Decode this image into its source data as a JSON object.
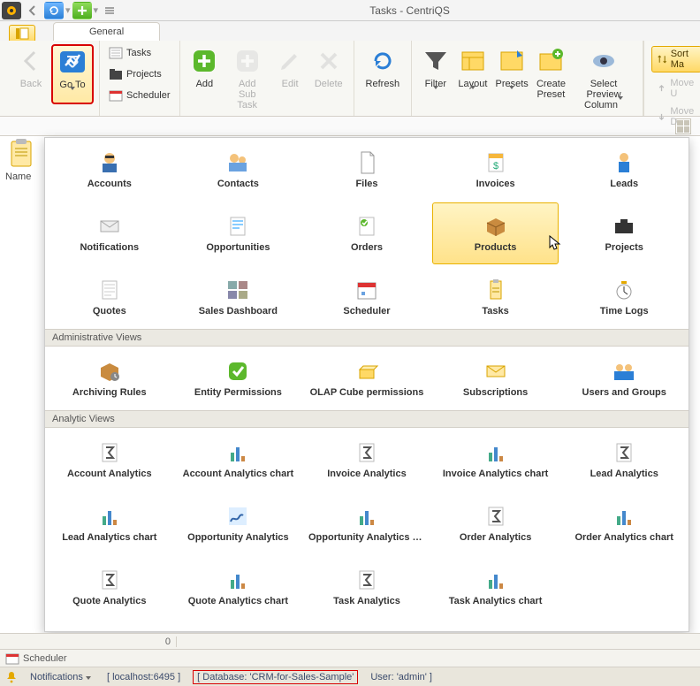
{
  "window": {
    "title": "Tasks - CentriQS"
  },
  "ribbon": {
    "tab_general": "General",
    "back": "Back",
    "goto": "Go To",
    "tasks": "Tasks",
    "projects": "Projects",
    "scheduler": "Scheduler",
    "add": "Add",
    "add_sub_task": "Add Sub\nTask",
    "edit": "Edit",
    "delete": "Delete",
    "refresh": "Refresh",
    "filter": "Filter",
    "layout": "Layout",
    "presets": "Presets",
    "create_preset": "Create\nPreset",
    "select_preview_column": "Select Preview\nColumn",
    "sort_ma": "Sort Ma",
    "move_u": "Move U",
    "move_d": "Move D"
  },
  "left": {
    "name_header": "Name"
  },
  "goto_panel": {
    "main": [
      {
        "key": "accounts",
        "label": "Accounts"
      },
      {
        "key": "contacts",
        "label": "Contacts"
      },
      {
        "key": "files",
        "label": "Files"
      },
      {
        "key": "invoices",
        "label": "Invoices"
      },
      {
        "key": "leads",
        "label": "Leads"
      },
      {
        "key": "notifications",
        "label": "Notifications"
      },
      {
        "key": "opportunities",
        "label": "Opportunities"
      },
      {
        "key": "orders",
        "label": "Orders"
      },
      {
        "key": "products",
        "label": "Products",
        "highlight": true
      },
      {
        "key": "projects",
        "label": "Projects"
      },
      {
        "key": "quotes",
        "label": "Quotes"
      },
      {
        "key": "sales_dashboard",
        "label": "Sales Dashboard"
      },
      {
        "key": "scheduler",
        "label": "Scheduler"
      },
      {
        "key": "tasks",
        "label": "Tasks"
      },
      {
        "key": "time_logs",
        "label": "Time Logs"
      }
    ],
    "admin_header": "Administrative Views",
    "admin": [
      {
        "key": "archiving_rules",
        "label": "Archiving Rules"
      },
      {
        "key": "entity_permissions",
        "label": "Entity Permissions"
      },
      {
        "key": "olap_cube_permissions",
        "label": "OLAP Cube permissions"
      },
      {
        "key": "subscriptions",
        "label": "Subscriptions"
      },
      {
        "key": "users_and_groups",
        "label": "Users and Groups"
      }
    ],
    "analytic_header": "Analytic Views",
    "analytic": [
      {
        "key": "account_analytics",
        "label": "Account Analytics"
      },
      {
        "key": "account_analytics_chart",
        "label": "Account Analytics chart"
      },
      {
        "key": "invoice_analytics",
        "label": "Invoice Analytics"
      },
      {
        "key": "invoice_analytics_chart",
        "label": "Invoice Analytics chart"
      },
      {
        "key": "lead_analytics",
        "label": "Lead Analytics"
      },
      {
        "key": "lead_analytics_chart",
        "label": "Lead Analytics chart"
      },
      {
        "key": "opportunity_analytics",
        "label": "Opportunity Analytics"
      },
      {
        "key": "opportunity_analytics_chart",
        "label": "Opportunity Analytics c..."
      },
      {
        "key": "order_analytics",
        "label": "Order Analytics"
      },
      {
        "key": "order_analytics_chart",
        "label": "Order Analytics chart"
      },
      {
        "key": "quote_analytics",
        "label": "Quote Analytics"
      },
      {
        "key": "quote_analytics_chart",
        "label": "Quote Analytics chart"
      },
      {
        "key": "task_analytics",
        "label": "Task Analytics"
      },
      {
        "key": "task_analytics_chart",
        "label": "Task Analytics chart"
      }
    ]
  },
  "bottom": {
    "zero": "0",
    "scheduler_tab": "Scheduler",
    "notifications": "Notifications",
    "host": "[ localhost:6495 ]",
    "database": "[ Database: 'CRM-for-Sales-Sample'",
    "user": "User: 'admin' ]"
  }
}
